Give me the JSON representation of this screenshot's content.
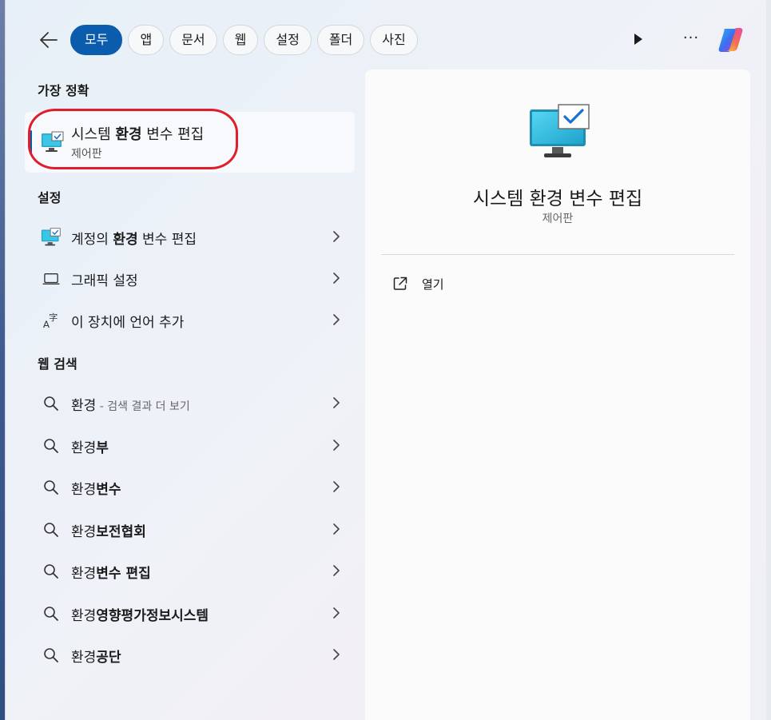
{
  "filters": {
    "back_label": "",
    "chips": [
      {
        "label": "모두",
        "active": true
      },
      {
        "label": "앱",
        "active": false
      },
      {
        "label": "문서",
        "active": false
      },
      {
        "label": "웹",
        "active": false
      },
      {
        "label": "설정",
        "active": false
      },
      {
        "label": "폴더",
        "active": false
      },
      {
        "label": "사진",
        "active": false
      }
    ]
  },
  "sections": {
    "best_match": "가장 정확",
    "settings": "설정",
    "web_search": "웹 검색"
  },
  "best_match": {
    "title_pre": "시스템 ",
    "title_bold": "환경",
    "title_post": " 변수 편집",
    "subtitle": "제어판",
    "icon": "monitor-check-icon"
  },
  "settings_items": [
    {
      "pre": "계정의 ",
      "bold": "환경",
      "post": " 변수 편집",
      "icon": "monitor-check-icon"
    },
    {
      "pre": "그래픽 설정",
      "bold": "",
      "post": "",
      "icon": "laptop-icon"
    },
    {
      "pre": "이 장치에 언어 추가",
      "bold": "",
      "post": "",
      "icon": "language-icon"
    }
  ],
  "web_items": [
    {
      "pre": "환경",
      "bold": "",
      "sub": " - 검색 결과 더 보기"
    },
    {
      "pre": "환경",
      "bold": "부",
      "sub": ""
    },
    {
      "pre": "환경",
      "bold": "변수",
      "sub": ""
    },
    {
      "pre": "환경",
      "bold": "보전협회",
      "sub": ""
    },
    {
      "pre": "환경",
      "bold": "변수 편집",
      "sub": ""
    },
    {
      "pre": "환경",
      "bold": "영향평가정보시스템",
      "sub": ""
    },
    {
      "pre": "환경",
      "bold": "공단",
      "sub": ""
    }
  ],
  "preview": {
    "title": "시스템 환경 변수 편집",
    "subtitle": "제어판",
    "open_label": "열기"
  },
  "colors": {
    "accent": "#0b5cad",
    "highlight": "#e01d2a"
  }
}
